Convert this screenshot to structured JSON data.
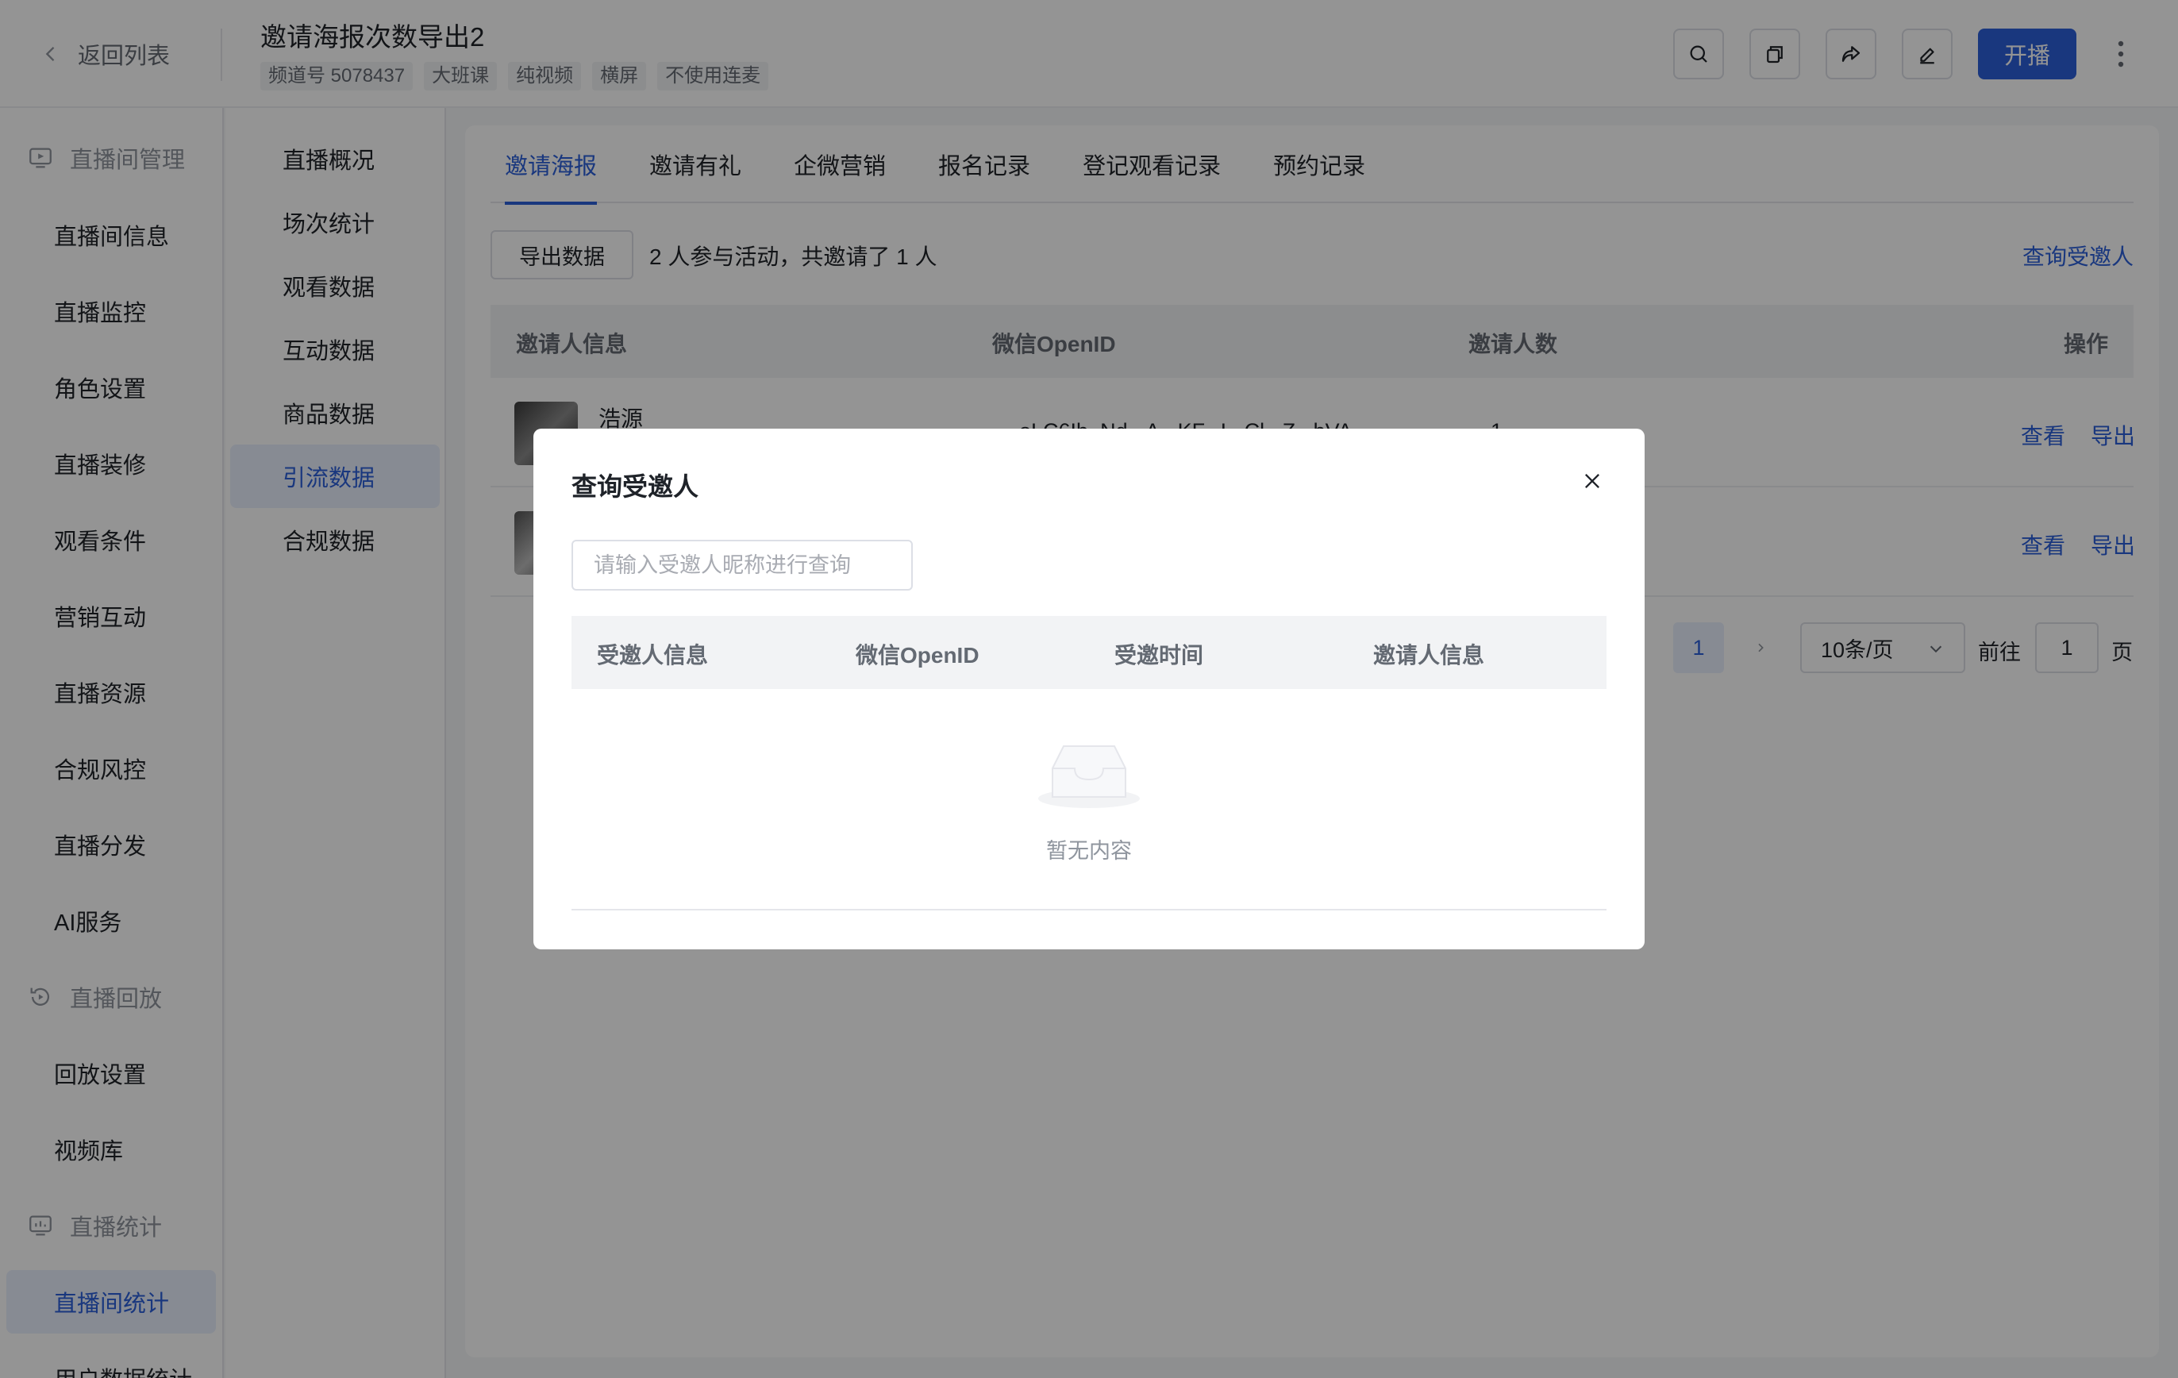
{
  "header": {
    "back_label": "返回列表",
    "title": "邀请海报次数导出2",
    "tags": [
      "频道号 5078437",
      "大班课",
      "纯视频",
      "横屏",
      "不使用连麦"
    ],
    "start_label": "开播",
    "accent_color": "#2b5fd9"
  },
  "sidebar": {
    "group_live": "直播间管理",
    "items_live": [
      "直播间信息",
      "直播监控",
      "角色设置",
      "直播装修",
      "观看条件",
      "营销互动",
      "直播资源",
      "合规风控",
      "直播分发",
      "AI服务"
    ],
    "group_replay": "直播回放",
    "items_replay": [
      "回放设置",
      "视频库"
    ],
    "group_stats": "直播统计",
    "items_stats": [
      "直播间统计",
      "用户数据统计"
    ],
    "active": "直播间统计"
  },
  "submenu": {
    "items": [
      "直播概况",
      "场次统计",
      "观看数据",
      "互动数据",
      "商品数据",
      "引流数据",
      "合规数据"
    ],
    "active": "引流数据"
  },
  "tabs": [
    "邀请海报",
    "邀请有礼",
    "企微营销",
    "报名记录",
    "登记观看记录",
    "预约记录"
  ],
  "active_tab": "邀请海报",
  "toolbar": {
    "export_label": "导出数据",
    "summary": "2 人参与活动，共邀请了 1 人",
    "query_link": "查询受邀人"
  },
  "table": {
    "columns": [
      "邀请人信息",
      "微信OpenID",
      "邀请人数",
      "操作"
    ],
    "rows": [
      {
        "name": "浩源",
        "openid": "oLC6Ib_Nd...A...KF...I...Cl...Z...bVA",
        "count": "1",
        "view": "查看",
        "export": "导出"
      },
      {
        "name": "",
        "openid": "",
        "count": "",
        "view": "查看",
        "export": "导出"
      }
    ]
  },
  "pagination": {
    "current_page": "1",
    "page_size": "10条/页",
    "goto_label": "前往",
    "goto_value": "1",
    "page_suffix": "页"
  },
  "modal": {
    "title": "查询受邀人",
    "search_placeholder": "请输入受邀人昵称进行查询",
    "columns": [
      "受邀人信息",
      "微信OpenID",
      "受邀时间",
      "邀请人信息"
    ],
    "empty_text": "暂无内容"
  }
}
